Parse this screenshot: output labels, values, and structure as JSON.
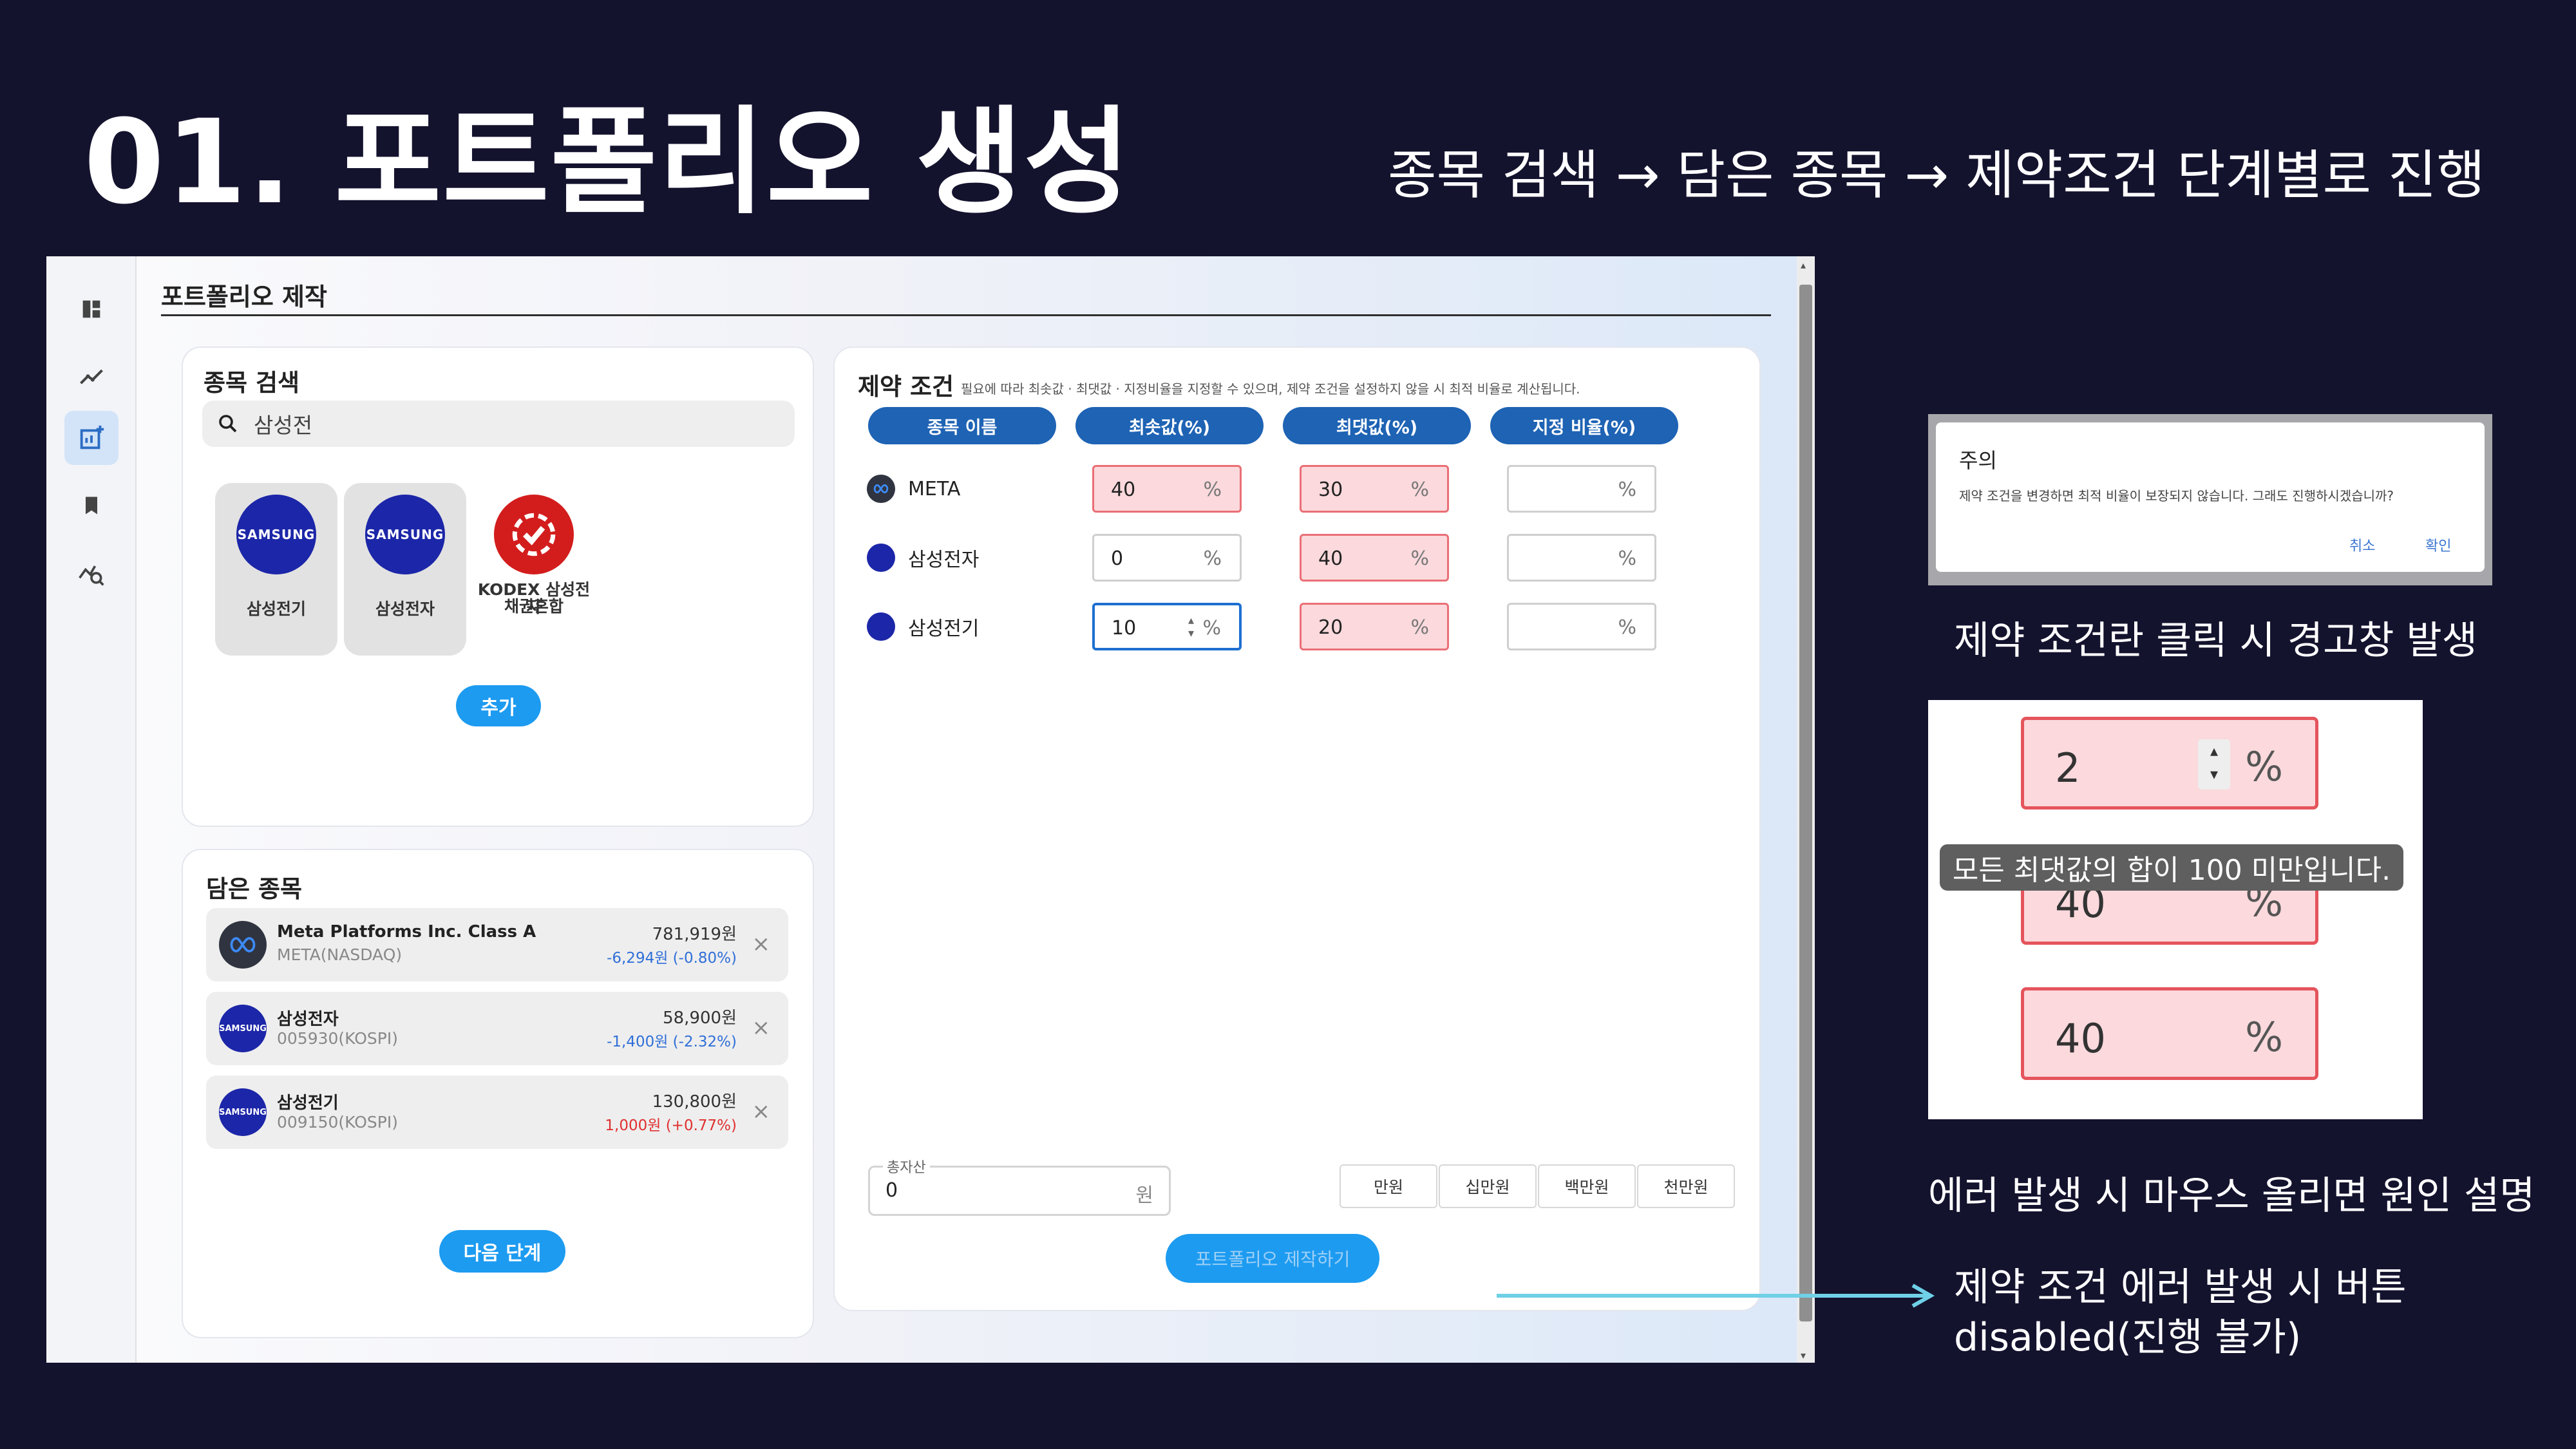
{
  "slide": {
    "title": "01. 포트폴리오 생성",
    "subtitle": "종목 검색 → 담은 종목 → 제약조건 단계별로 진행"
  },
  "app": {
    "title": "포트폴리오 제작",
    "sidebar": [
      "dashboard-icon",
      "trend-icon",
      "add-chart-icon",
      "bookmark-icon",
      "analysis-icon"
    ],
    "search": {
      "heading": "종목 검색",
      "query": "삼성전",
      "results": [
        {
          "name": "삼성전기",
          "logo_text": "SAMSUNG"
        },
        {
          "name": "삼성전자",
          "logo_text": "SAMSUNG"
        },
        {
          "name_line1": "KODEX 삼성전자",
          "name_line2": "채권혼합"
        }
      ],
      "add_label": "추가"
    },
    "holdings": {
      "heading": "담은 종목",
      "items": [
        {
          "name": "Meta Platforms Inc. Class A",
          "code": "META(NASDAQ)",
          "price": "781,919원",
          "change": "-6,294원 (-0.80%)"
        },
        {
          "name": "삼성전자",
          "code": "005930(KOSPI)",
          "price": "58,900원",
          "change": "-1,400원 (-2.32%)",
          "logo_text": "SAMSUNG"
        },
        {
          "name": "삼성전기",
          "code": "009150(KOSPI)",
          "price": "130,800원",
          "change": "1,000원 (+0.77%)",
          "logo_text": "SAMSUNG"
        }
      ],
      "remove_glyph": "×",
      "next_label": "다음 단계"
    },
    "constraints": {
      "heading": "제약 조건",
      "hint": "필요에 따라 최솟값 · 최댓값 · 지정비율을 지정할 수 있으며, 제약 조건을 설정하지 않을 시 최적 비율로 계산됩니다.",
      "headers": [
        "종목 이름",
        "최솟값(%)",
        "최댓값(%)",
        "지정 비율(%)"
      ],
      "unit": "%",
      "rows": [
        {
          "name": "META",
          "min": "40",
          "max": "30",
          "fixed": ""
        },
        {
          "name": "삼성전자",
          "min": "0",
          "max": "40",
          "fixed": ""
        },
        {
          "name": "삼성전기",
          "min": "10",
          "max": "20",
          "fixed": ""
        }
      ],
      "total_asset_label": "총자산",
      "total_asset_value": "0",
      "currency_unit": "원",
      "amount_buttons": [
        "만원",
        "십만원",
        "백만원",
        "천만원"
      ],
      "create_label": "포트폴리오 제작하기"
    }
  },
  "dialog": {
    "title": "주의",
    "message": "제약 조건을 변경하면 최적 비율이 보장되지 않습니다. 그래도 진행하시겠습니까?",
    "cancel": "취소",
    "confirm": "확인"
  },
  "annotations": {
    "dialog_caption": "제약 조건란 클릭 시 경고창 발생",
    "error_caption": "에러 발생 시 마우스 올리면 원인 설명",
    "disabled_line1": "제약 조건 에러 발생 시 버튼",
    "disabled_line2": "disabled(진행 불가)"
  },
  "error_example": {
    "values": [
      "2",
      "40",
      "40"
    ],
    "unit": "%",
    "tooltip": "모든 최댓값의 합이 100 미만입니다."
  },
  "colors": {
    "background": "#14132e",
    "primary_button": "#1d9bf0",
    "header_pill": "#1e63b4",
    "error_fill": "#fbd9dc",
    "arrow": "#6fd0e6",
    "down": "#2f6fd8",
    "up": "#e03030"
  }
}
